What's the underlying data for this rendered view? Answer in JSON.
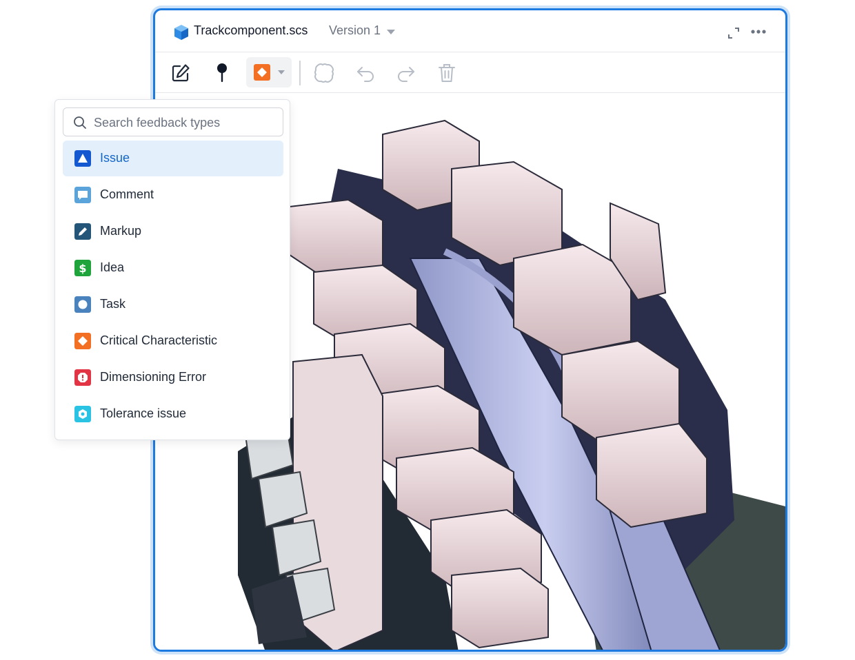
{
  "window": {
    "file_name": "Trackcomponent.scs",
    "version_label": "Version 1",
    "icons": [
      "cube-icon",
      "expand-icon",
      "more-icon",
      "chevron-down-icon"
    ]
  },
  "toolbar": {
    "tools": [
      "edit-icon",
      "pin-icon",
      "feedback-type-icon",
      "lasso-select-icon",
      "undo-icon",
      "redo-icon",
      "trash-icon"
    ],
    "active_tool": "feedback-type-icon"
  },
  "dropdown": {
    "search_placeholder": "Search feedback types",
    "items": [
      {
        "label": "Issue",
        "icon": "issue-icon",
        "color": "#1458d1",
        "selected": true
      },
      {
        "label": "Comment",
        "icon": "comment-icon",
        "color": "#5aa3db",
        "selected": false
      },
      {
        "label": "Markup",
        "icon": "markup-icon",
        "color": "#24567a",
        "selected": false
      },
      {
        "label": "Idea",
        "icon": "idea-icon",
        "color": "#1fa33b",
        "selected": false
      },
      {
        "label": "Task",
        "icon": "task-icon",
        "color": "#4a82bd",
        "selected": false
      },
      {
        "label": "Critical Characteristic",
        "icon": "critical-characteristic-icon",
        "color": "#f26f24",
        "selected": false
      },
      {
        "label": "Dimensioning Error",
        "icon": "dimensioning-error-icon",
        "color": "#e33445",
        "selected": false
      },
      {
        "label": "Tolerance issue",
        "icon": "tolerance-issue-icon",
        "color": "#2bc3e3",
        "selected": false
      }
    ]
  },
  "colors": {
    "accent": "#1d7ae0",
    "selected_bg": "#e3effb",
    "selected_text": "#1467c9"
  }
}
